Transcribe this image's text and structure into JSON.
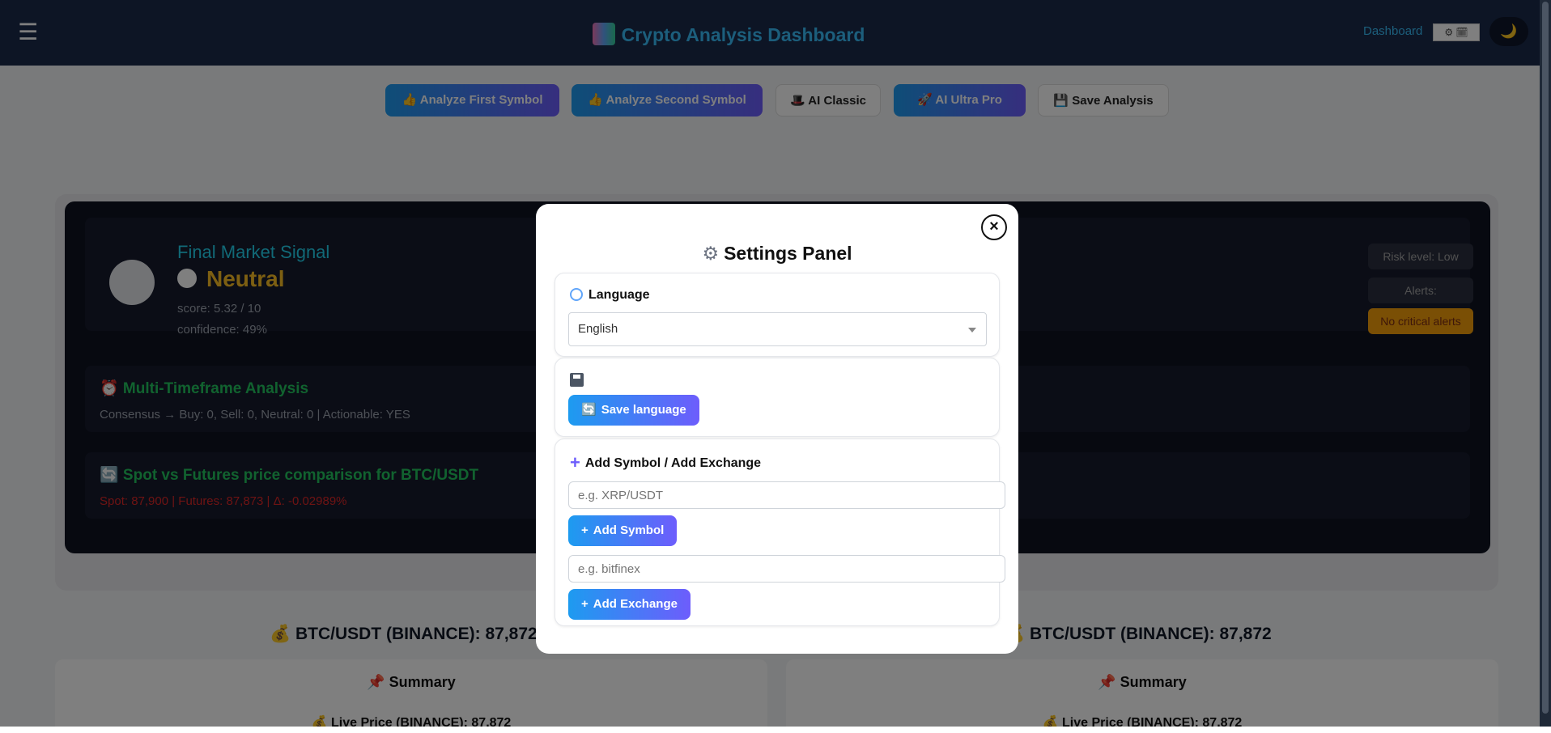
{
  "header": {
    "menu_icon": "☰",
    "title": "Crypto Analysis Dashboard",
    "dashboard_link": "Dashboard",
    "theme_switch": "⚙ 🗓",
    "dark_mode_icon": "🌙"
  },
  "toolbar": {
    "analyze_first": "👍 Analyze First Symbol",
    "analyze_second": "👍 Analyze Second Symbol",
    "ai_classic": "🎩 AI Classic",
    "ai_ultra": "🚀 AI Ultra Pro",
    "save_analysis": "💾 Save Analysis"
  },
  "signal": {
    "title": "Final Market Signal",
    "value": "Neutral",
    "score": "score: 5.32 / 10",
    "confidence": "confidence: 49%",
    "risk_level": "Risk level: Low",
    "alerts_label": "Alerts:",
    "alerts_value": "No critical alerts"
  },
  "multi_timeframe": {
    "title": "⏰ Multi-Timeframe Analysis",
    "consensus": "Consensus → Buy: 0, Sell: 0, Neutral: 0 | Actionable: YES"
  },
  "spot_futures": {
    "title": "🔄 Spot vs Futures price comparison for BTC/USDT",
    "text": "Spot: 87,900 | Futures: 87,873 | Δ: -0.02989%"
  },
  "pairs": {
    "left_title": "💰 BTC/USDT (BINANCE): 87,872",
    "right_title": "💰 BTC/USDT (BINANCE): 87,872",
    "summary_title": "📌 Summary",
    "live_price": "💰 Live Price (BINANCE): 87,872"
  },
  "modal": {
    "close_icon": "×",
    "title": "Settings Panel",
    "gear_icon": "⚙",
    "language_label": "Language",
    "language_value": "English",
    "save_language": "Save language",
    "add_section_title": "Add Symbol / Add Exchange",
    "symbol_placeholder": "e.g. XRP/USDT",
    "add_symbol": "Add Symbol",
    "exchange_placeholder": "e.g. bitfinex",
    "add_exchange": "Add Exchange",
    "refresh_icon": "🔄",
    "plus_icon": "+"
  },
  "colors": {
    "header_bg": "#1a2b4a",
    "accent_blue": "#1d9bf0",
    "accent_purple": "#6d5dfc",
    "title_cyan": "#38bdf8",
    "signal_amber": "#fbbf24"
  }
}
